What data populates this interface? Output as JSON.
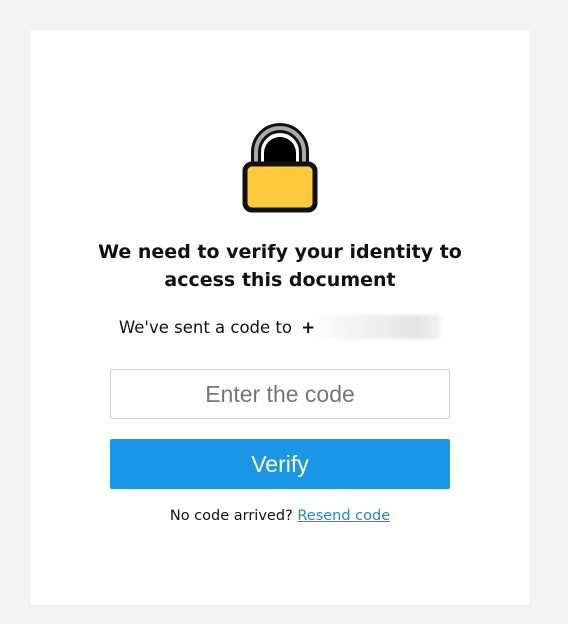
{
  "dialog": {
    "title": "We need to verify your identity to access this document",
    "sent_prefix": "We've sent a code to ",
    "phone_visible": "+",
    "code_placeholder": "Enter the code",
    "code_value": "",
    "verify_label": "Verify",
    "no_code_text": "No code arrived? ",
    "resend_label": "Resend code"
  },
  "icons": {
    "lock": "lock-icon"
  },
  "colors": {
    "page_bg": "#f3f3f3",
    "card_bg": "#ffffff",
    "button_bg": "#1a96e6",
    "link": "#1a8ad4",
    "lock_body": "#ffc83d"
  }
}
